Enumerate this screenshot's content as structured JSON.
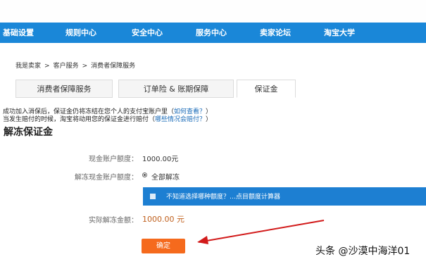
{
  "nav": {
    "items": [
      "基础设置",
      "规则中心",
      "安全中心",
      "服务中心",
      "卖家论坛",
      "淘宝大学"
    ]
  },
  "breadcrumb": {
    "items": [
      "我是卖家",
      "客户服务",
      "消费者保障服务"
    ],
    "separator": ">"
  },
  "tabs": [
    "消费者保障服务",
    "订单险 & 账期保障",
    "保证金"
  ],
  "notice": {
    "line1_text": "成功加入消保后，保证金仍将冻结在您个人的支付宝账户里（",
    "line1_link": "如何查看？",
    "line1_end": "）",
    "line2_text": "当发生赔付的时候，淘宝将动用您的保证金进行赔付（",
    "line2_link": "哪些情况会赔付？",
    "line2_end": "）"
  },
  "section": {
    "title": "解冻保证金"
  },
  "form": {
    "cash_limit_label": "现金账户额度：",
    "cash_limit_value": "1000.00元",
    "unfreeze_limit_label": "解冻现金账户额度：",
    "unfreeze_option": "全部解冻",
    "calc_text": "不知道选择哪种额度？…点目额度计算器",
    "actual_label": "实际解冻金额：",
    "actual_value": "1000.00 元",
    "confirm_label": "确定"
  },
  "watermark": "头条 @沙漠中海洋01",
  "colors": {
    "nav": "#1a87d8",
    "confirm": "#f56a1d",
    "arrow": "#d21a1a",
    "amount": "#c0601e"
  }
}
